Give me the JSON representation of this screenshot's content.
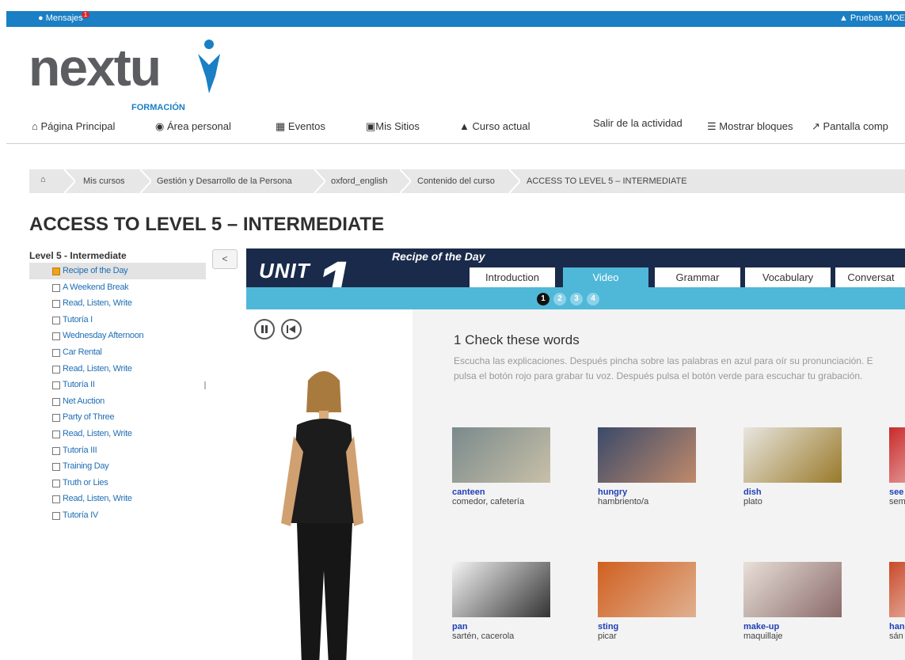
{
  "topbar": {
    "messages_label": "Mensajes",
    "messages_count": "1",
    "user_label": "Pruebas MOE"
  },
  "logo": {
    "text": "nextu",
    "sub": "FORMACIÓN"
  },
  "nav": {
    "home": "Página Principal",
    "personal": "Área personal",
    "events": "Eventos",
    "sites": "Mis Sitios",
    "course": "Curso actual",
    "exit": "Salir de la actividad",
    "blocks": "Mostrar bloques",
    "fullscreen": "Pantalla comp"
  },
  "breadcrumb": {
    "items": [
      "Mis cursos",
      "Gestión y Desarrollo de la Persona",
      "oxford_english",
      "Contenido del curso",
      "ACCESS TO LEVEL 5 – INTERMEDIATE"
    ]
  },
  "page_title": "ACCESS TO LEVEL 5 – INTERMEDIATE",
  "tree": {
    "title": "Level 5 - Intermediate",
    "collapse_label": "<",
    "items": [
      "Recipe of the Day",
      "A Weekend Break",
      "Read, Listen, Write",
      "Tutoría I",
      "Wednesday Afternoon",
      "Car Rental",
      "Read, Listen, Write",
      "Tutoría II",
      "Net Auction",
      "Party of Three",
      "Read, Listen, Write",
      "Tutoría III",
      "Training Day",
      "Truth or Lies",
      "Read, Listen, Write",
      "Tutoría IV"
    ],
    "active_index": 0
  },
  "activity": {
    "unit_label": "UNIT",
    "unit_number": "1",
    "lesson_title": "Recipe of the Day",
    "tabs": [
      "Introduction",
      "Video",
      "Grammar",
      "Vocabulary",
      "Conversat"
    ],
    "active_tab": 1,
    "steps": [
      "1",
      "2",
      "3",
      "4"
    ],
    "active_step": 0,
    "section_title": "1  Check these words",
    "instructions_line1": "Escucha las explicaciones. Después pincha sobre las palabras en azul para oír su pronunciación. E",
    "instructions_line2": "pulsa el botón rojo para grabar tu voz. Después pulsa el botón verde para escuchar tu grabación.",
    "words": [
      {
        "word": "canteen",
        "translation": "comedor, cafetería"
      },
      {
        "word": "hungry",
        "translation": "hambriento/a"
      },
      {
        "word": "dish",
        "translation": "plato"
      },
      {
        "word": "see",
        "translation": "sem"
      },
      {
        "word": "pan",
        "translation": "sartén, cacerola"
      },
      {
        "word": "sting",
        "translation": "picar"
      },
      {
        "word": "make-up",
        "translation": "maquillaje"
      },
      {
        "word": "han",
        "translation": "sán"
      }
    ]
  },
  "colors": {
    "brand_blue": "#1a7fc4",
    "header_navy": "#1a2a4a",
    "tab_cyan": "#4fb8d8",
    "word_blue": "#1f3fb5"
  }
}
